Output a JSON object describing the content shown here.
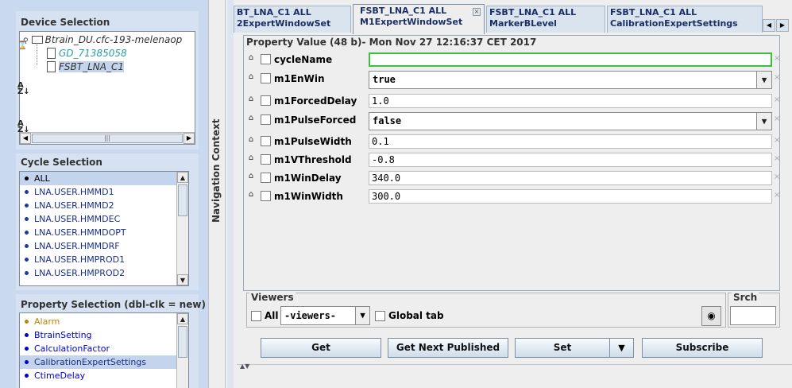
{
  "device_selection": {
    "title": "Device Selection",
    "tree": [
      {
        "label": "Btrain_DU.cfc-193-melenaop",
        "kind": "folder",
        "color": "#333333"
      },
      {
        "label": "GD_71385058",
        "kind": "device",
        "color": "#2a9d9d"
      },
      {
        "label": "FSBT_LNA_C1",
        "kind": "device",
        "color": "#333333",
        "selected": true
      }
    ]
  },
  "cycle_selection": {
    "title": "Cycle Selection",
    "items": [
      {
        "label": "ALL",
        "selected": true
      },
      {
        "label": "LNA.USER.HMMD1"
      },
      {
        "label": "LNA.USER.HMMD2"
      },
      {
        "label": "LNA.USER.HMMDEC"
      },
      {
        "label": "LNA.USER.HMMDOPT"
      },
      {
        "label": "LNA.USER.HMMDRF"
      },
      {
        "label": "LNA.USER.HMPROD1"
      },
      {
        "label": "LNA.USER.HMPROD2"
      }
    ]
  },
  "property_selection": {
    "title": "Property Selection (dbl-clk = new)",
    "items": [
      {
        "label": "Alarm",
        "color": "#b8860b"
      },
      {
        "label": "BtrainSetting",
        "color": "#0000cc"
      },
      {
        "label": "CalculationFactor",
        "color": "#0000cc"
      },
      {
        "label": "CalibrationExpertSettings",
        "color": "#0000cc",
        "selected": true
      },
      {
        "label": "CtimeDelay",
        "color": "#0000cc"
      }
    ]
  },
  "navigation_context": {
    "label": "Navigation Context"
  },
  "tabs": [
    {
      "line1": "BT_LNA_C1 ALL",
      "line2": "2ExpertWindowSet",
      "active": false
    },
    {
      "line1": "FSBT_LNA_C1 ALL",
      "line2": "M1ExpertWindowSet",
      "active": true
    },
    {
      "line1": "FSBT_LNA_C1 ALL",
      "line2": "MarkerBLevel",
      "active": false
    },
    {
      "line1": "FSBT_LNA_C1 ALL",
      "line2": "CalibrationExpertSettings",
      "active": false
    }
  ],
  "property_value": {
    "header": "Property Value (48 b)- Mon Nov 27 12:16:37 CET 2017",
    "fields": [
      {
        "name": "cycleName",
        "value": "",
        "type": "text",
        "focused": true
      },
      {
        "name": "m1EnWin",
        "value": "true",
        "type": "select"
      },
      {
        "name": "m1ForcedDelay",
        "value": "1.0",
        "type": "text"
      },
      {
        "name": "m1PulseForced",
        "value": "false",
        "type": "select"
      },
      {
        "name": "m1PulseWidth",
        "value": "0.1",
        "type": "text"
      },
      {
        "name": "m1VThreshold",
        "value": "-0.8",
        "type": "text"
      },
      {
        "name": "m1WinDelay",
        "value": "340.0",
        "type": "text"
      },
      {
        "name": "m1WinWidth",
        "value": "300.0",
        "type": "text"
      }
    ]
  },
  "viewers": {
    "title": "Viewers",
    "all_label": "All",
    "select_value": "-viewers-",
    "global_tab_label": "Global tab",
    "search_title": "Srch"
  },
  "actions": {
    "get": "Get",
    "get_next_published": "Get Next Published",
    "set": "Set",
    "subscribe": "Subscribe"
  }
}
